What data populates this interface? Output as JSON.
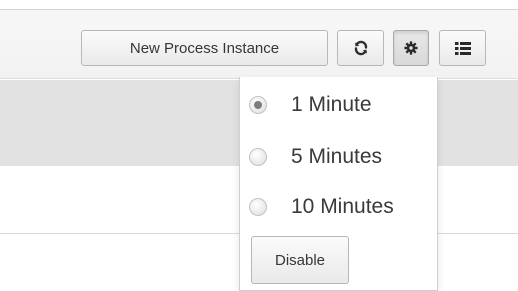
{
  "toolbar": {
    "new_process_instance_label": "New Process Instance",
    "refresh_icon": "refresh-icon",
    "settings_icon": "gear-icon",
    "list_icon": "list-icon"
  },
  "refresh_menu": {
    "options": [
      {
        "label": "1 Minute",
        "selected": true
      },
      {
        "label": "5 Minutes",
        "selected": false
      },
      {
        "label": "10 Minutes",
        "selected": false
      }
    ],
    "disable_label": "Disable"
  },
  "colors": {
    "toolbar_bg": "#f4f4f4",
    "band_bg": "#e2e2e2",
    "button_border": "#b7b7b7",
    "radio_dot": "#7d7d7d"
  }
}
